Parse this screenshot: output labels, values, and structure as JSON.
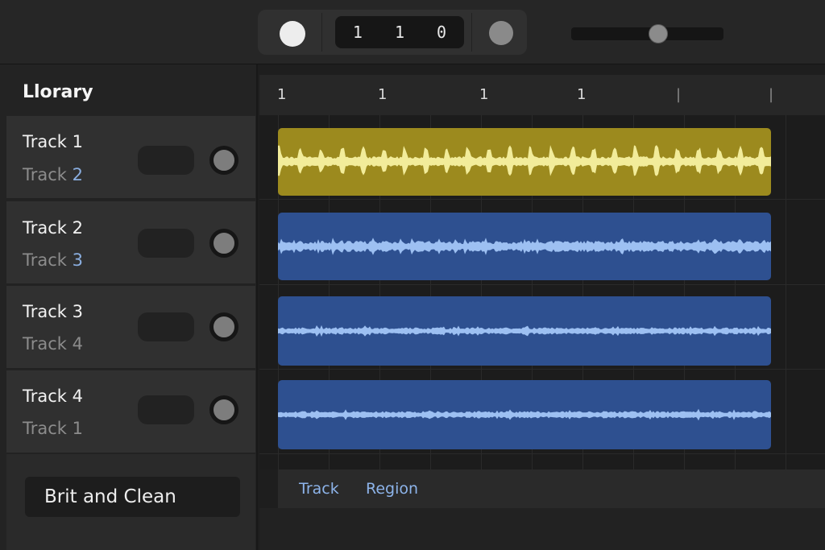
{
  "transport": {
    "counter": "1 1 0",
    "tempo_slider_value": 0.57
  },
  "library": {
    "title": "Llorary",
    "tracks": [
      {
        "name": "Track 1",
        "sub_prefix": "Track ",
        "sub_num": "2"
      },
      {
        "name": "Track 2",
        "sub_prefix": "Track ",
        "sub_num": "3"
      },
      {
        "name": "Track 3",
        "sub_prefix": "Track ",
        "sub_num": "4"
      },
      {
        "name": "Track 4",
        "sub_prefix": "Track ",
        "sub_num": "1"
      }
    ],
    "preset": "Brit and Clean"
  },
  "ruler": {
    "marks": [
      "1",
      "1",
      "1",
      "1",
      "|",
      "|"
    ]
  },
  "regions": [
    {
      "color": "#9c8a1e",
      "wave_color": "#f2ec9a",
      "style": "spiky"
    },
    {
      "color": "#2e5090",
      "wave_color": "#9dc0f2",
      "style": "dense"
    },
    {
      "color": "#2e5090",
      "wave_color": "#9dc0f2",
      "style": "light"
    },
    {
      "color": "#2e5090",
      "wave_color": "#9dc0f2",
      "style": "light"
    }
  ],
  "tabs": {
    "track": "Track",
    "region": "Region"
  },
  "colors": {
    "accent_text": "#8db4ea",
    "yellow_region": "#9c8a1e",
    "blue_region": "#2e5090"
  }
}
